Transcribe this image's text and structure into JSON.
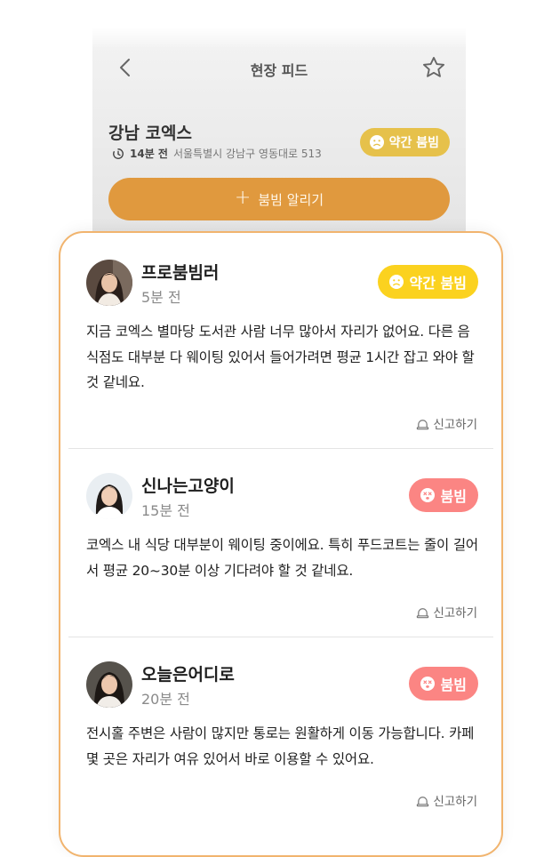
{
  "header": {
    "title": "현장 피드"
  },
  "place": {
    "name": "강남 코엑스",
    "time_ago": "14분 전",
    "address": "서울특별시 강남구 영동대로 513",
    "status": "약간 붐빔"
  },
  "actions": {
    "notify_label": "붐빔 알리기"
  },
  "colors": {
    "accent_orange": "#e0993e",
    "card_border": "#f1b46e",
    "status_slightly_busy": "#fbd21f",
    "status_busy": "#fb8583"
  },
  "posts": [
    {
      "nickname": "프로붐빔러",
      "time_ago": "5분 전",
      "status": "약간 붐빔",
      "status_icon": "frown-face-icon",
      "text": "지금 코엑스 별마당 도서관 사람 너무 많아서 자리가 없어요. 다른 음식점도 대부분 다 웨이팅 있어서 들어가려면 평균 1시간 잡고 와야 할 것 같네요.",
      "report_label": "신고하기"
    },
    {
      "nickname": "신나는고양이",
      "time_ago": "15분 전",
      "status": "붐빔",
      "status_icon": "dizzy-face-icon",
      "text": "코엑스 내 식당 대부분이 웨이팅 중이에요. 특히 푸드코트는 줄이 길어서 평균 20~30분 이상 기다려야 할 것 같네요.",
      "report_label": "신고하기"
    },
    {
      "nickname": "오늘은어디로",
      "time_ago": "20분 전",
      "status": "붐빔",
      "status_icon": "dizzy-face-icon",
      "text": "전시홀 주변은 사람이 많지만 통로는 원활하게 이동 가능합니다. 카페 몇 곳은 자리가 여유 있어서 바로 이용할 수 있어요.",
      "report_label": "신고하기"
    }
  ]
}
